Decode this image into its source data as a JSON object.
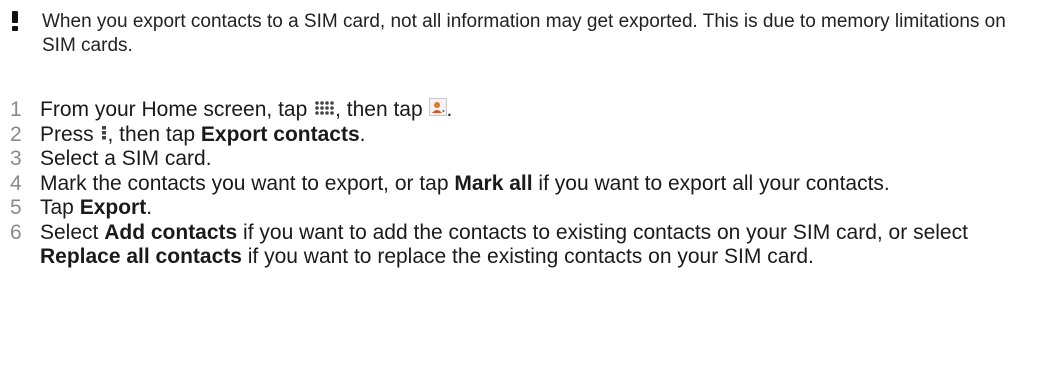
{
  "note": {
    "icon": "exclamation-icon",
    "text": "When you export contacts to a SIM card, not all information may get exported. This is due to memory limitations on SIM cards."
  },
  "steps": [
    {
      "number": "1",
      "parts": [
        "From your Home screen, tap ",
        ", then tap ",
        "."
      ],
      "icons": [
        "apps-grid-icon",
        "contacts-icon"
      ]
    },
    {
      "number": "2",
      "parts": [
        "Press ",
        ", then tap ",
        "."
      ],
      "icons": [
        "menu-dots-icon"
      ],
      "bold": [
        "Export contacts"
      ]
    },
    {
      "number": "3",
      "parts": [
        "Select a SIM card."
      ]
    },
    {
      "number": "4",
      "parts": [
        "Mark the contacts you want to export, or tap ",
        " if you want to export all your contacts."
      ],
      "bold": [
        "Mark all"
      ]
    },
    {
      "number": "5",
      "parts": [
        "Tap ",
        "."
      ],
      "bold": [
        "Export"
      ]
    },
    {
      "number": "6",
      "parts": [
        "Select ",
        " if you want to add the contacts to existing contacts on your SIM card, or select ",
        " if you want to replace the existing contacts on your SIM card."
      ],
      "bold": [
        "Add contacts",
        "Replace all contacts"
      ]
    }
  ]
}
